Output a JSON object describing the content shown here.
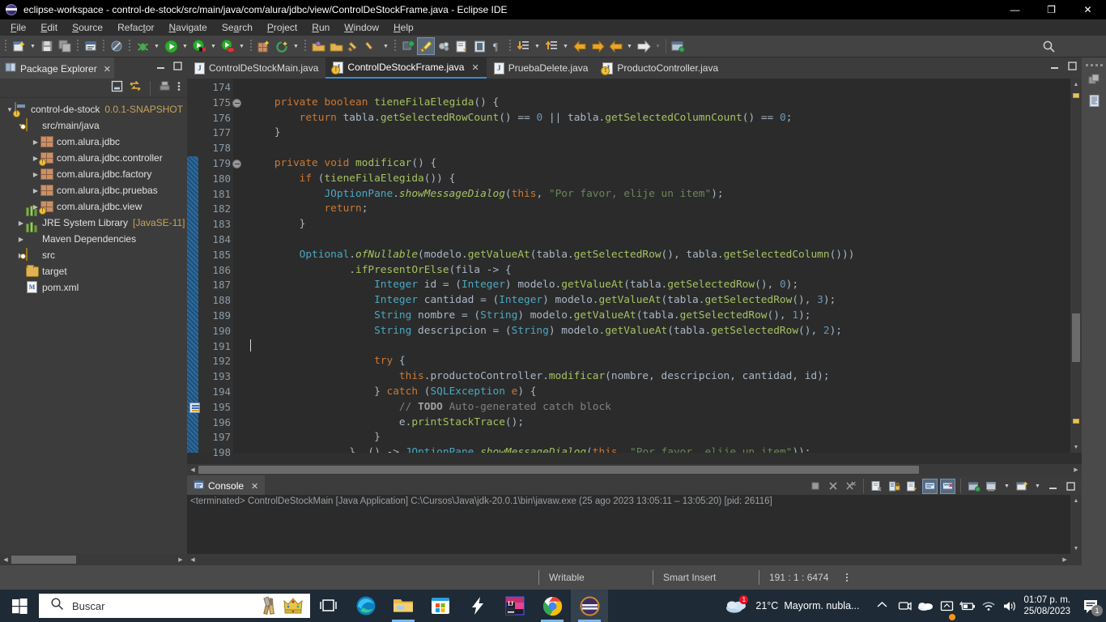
{
  "window": {
    "title": "eclipse-workspace - control-de-stock/src/main/java/com/alura/jdbc/view/ControlDeStockFrame.java - Eclipse IDE",
    "app_icon": "eclipse-icon",
    "restore_label": "❐",
    "close_label": "✕"
  },
  "menubar": [
    {
      "label": "File",
      "mnemonic": "F"
    },
    {
      "label": "Edit",
      "mnemonic": "E"
    },
    {
      "label": "Source",
      "mnemonic": "S"
    },
    {
      "label": "Refactor",
      "mnemonic": "t"
    },
    {
      "label": "Navigate",
      "mnemonic": "N"
    },
    {
      "label": "Search",
      "mnemonic": "a"
    },
    {
      "label": "Project",
      "mnemonic": "P"
    },
    {
      "label": "Run",
      "mnemonic": "R"
    },
    {
      "label": "Window",
      "mnemonic": "W"
    },
    {
      "label": "Help",
      "mnemonic": "H"
    }
  ],
  "package_explorer": {
    "tab_label": "Package Explorer",
    "close_label": "✕",
    "toolbar_icons": [
      "collapse-all-icon",
      "link-with-editor-icon",
      "view-menu-filter-icon",
      "view-menu-icon"
    ],
    "tree": [
      {
        "indent": 0,
        "twisty": "down",
        "icon": "java-project-icon",
        "label": "control-de-stock",
        "sub": "0.0.1-SNAPSHOT"
      },
      {
        "indent": 1,
        "twisty": "down",
        "icon": "source-folder-icon",
        "label": "src/main/java",
        "sub": ""
      },
      {
        "indent": 2,
        "twisty": "right",
        "icon": "package-icon",
        "label": "com.alura.jdbc",
        "sub": ""
      },
      {
        "indent": 2,
        "twisty": "right",
        "icon": "package-warning-icon",
        "label": "com.alura.jdbc.controller",
        "sub": ""
      },
      {
        "indent": 2,
        "twisty": "right",
        "icon": "package-icon",
        "label": "com.alura.jdbc.factory",
        "sub": ""
      },
      {
        "indent": 2,
        "twisty": "right",
        "icon": "package-icon",
        "label": "com.alura.jdbc.pruebas",
        "sub": ""
      },
      {
        "indent": 2,
        "twisty": "right",
        "icon": "package-warning-icon",
        "label": "com.alura.jdbc.view",
        "sub": ""
      },
      {
        "indent": 1,
        "twisty": "right",
        "icon": "library-icon",
        "label": "JRE System Library",
        "sub": "[JavaSE-11]"
      },
      {
        "indent": 1,
        "twisty": "right",
        "icon": "library-icon",
        "label": "Maven Dependencies",
        "sub": ""
      },
      {
        "indent": 1,
        "twisty": "right",
        "icon": "source-folder-icon",
        "label": "src",
        "sub": ""
      },
      {
        "indent": 1,
        "twisty": "none",
        "icon": "folder-icon",
        "label": "target",
        "sub": ""
      },
      {
        "indent": 1,
        "twisty": "none",
        "icon": "xml-file-icon",
        "label": "pom.xml",
        "sub": ""
      }
    ]
  },
  "editor": {
    "tabs": [
      {
        "label": "ControlDeStockMain.java",
        "icon": "java-file-icon",
        "active": false,
        "closable": false
      },
      {
        "label": "ControlDeStockFrame.java",
        "icon": "java-warning-file-icon",
        "active": true,
        "closable": true
      },
      {
        "label": "PruebaDelete.java",
        "icon": "java-file-icon",
        "active": false,
        "closable": false
      },
      {
        "label": "ProductoController.java",
        "icon": "java-warning-file-icon",
        "active": false,
        "closable": false
      }
    ],
    "close_label": "✕",
    "first_line": 174,
    "last_line": 198,
    "fold_lines": [
      175,
      179
    ],
    "todo_marker_line": 195,
    "caret_line": 191,
    "lines": [
      {
        "n": 174,
        "tokens": []
      },
      {
        "n": 175,
        "tokens": [
          {
            "t": "    ",
            "c": "t"
          },
          {
            "t": "private",
            "c": "k"
          },
          {
            "t": " ",
            "c": "t"
          },
          {
            "t": "boolean",
            "c": "k"
          },
          {
            "t": " ",
            "c": "t"
          },
          {
            "t": "tieneFilaElegida",
            "c": "m"
          },
          {
            "t": "() {",
            "c": "t"
          }
        ]
      },
      {
        "n": 176,
        "tokens": [
          {
            "t": "        ",
            "c": "t"
          },
          {
            "t": "return",
            "c": "k"
          },
          {
            "t": " tabla.",
            "c": "t"
          },
          {
            "t": "getSelectedRowCount",
            "c": "m"
          },
          {
            "t": "() ",
            "c": "t"
          },
          {
            "t": "==",
            "c": "t"
          },
          {
            "t": " ",
            "c": "t"
          },
          {
            "t": "0",
            "c": "n"
          },
          {
            "t": " || tabla.",
            "c": "t"
          },
          {
            "t": "getSelectedColumnCount",
            "c": "m"
          },
          {
            "t": "() == ",
            "c": "t"
          },
          {
            "t": "0",
            "c": "n"
          },
          {
            "t": ";",
            "c": "t"
          }
        ]
      },
      {
        "n": 177,
        "tokens": [
          {
            "t": "    }",
            "c": "t"
          }
        ]
      },
      {
        "n": 178,
        "tokens": []
      },
      {
        "n": 179,
        "tokens": [
          {
            "t": "    ",
            "c": "t"
          },
          {
            "t": "private",
            "c": "k"
          },
          {
            "t": " ",
            "c": "t"
          },
          {
            "t": "void",
            "c": "k"
          },
          {
            "t": " ",
            "c": "t"
          },
          {
            "t": "modificar",
            "c": "m"
          },
          {
            "t": "() {",
            "c": "t"
          }
        ]
      },
      {
        "n": 180,
        "tokens": [
          {
            "t": "        ",
            "c": "t"
          },
          {
            "t": "if",
            "c": "k"
          },
          {
            "t": " (",
            "c": "t"
          },
          {
            "t": "tieneFilaElegida",
            "c": "m"
          },
          {
            "t": "()) {",
            "c": "t"
          }
        ]
      },
      {
        "n": 181,
        "tokens": [
          {
            "t": "            ",
            "c": "t"
          },
          {
            "t": "JOptionPane",
            "c": "cyan"
          },
          {
            "t": ".",
            "c": "t"
          },
          {
            "t": "showMessageDialog",
            "c": "m it"
          },
          {
            "t": "(",
            "c": "t"
          },
          {
            "t": "this",
            "c": "k"
          },
          {
            "t": ", ",
            "c": "t"
          },
          {
            "t": "\"Por favor, elije un item\"",
            "c": "st"
          },
          {
            "t": ");",
            "c": "t"
          }
        ]
      },
      {
        "n": 182,
        "tokens": [
          {
            "t": "            ",
            "c": "t"
          },
          {
            "t": "return",
            "c": "k"
          },
          {
            "t": ";",
            "c": "t"
          }
        ]
      },
      {
        "n": 183,
        "tokens": [
          {
            "t": "        }",
            "c": "t"
          }
        ]
      },
      {
        "n": 184,
        "tokens": []
      },
      {
        "n": 185,
        "tokens": [
          {
            "t": "        ",
            "c": "t"
          },
          {
            "t": "Optional",
            "c": "cyan"
          },
          {
            "t": ".",
            "c": "t"
          },
          {
            "t": "ofNullable",
            "c": "m it"
          },
          {
            "t": "(modelo.",
            "c": "t"
          },
          {
            "t": "getValueAt",
            "c": "m"
          },
          {
            "t": "(tabla.",
            "c": "t"
          },
          {
            "t": "getSelectedRow",
            "c": "m"
          },
          {
            "t": "(), tabla.",
            "c": "t"
          },
          {
            "t": "getSelectedColumn",
            "c": "m"
          },
          {
            "t": "()))",
            "c": "t"
          }
        ]
      },
      {
        "n": 186,
        "tokens": [
          {
            "t": "                .",
            "c": "t"
          },
          {
            "t": "ifPresentOrElse",
            "c": "m"
          },
          {
            "t": "(fila -> {",
            "c": "t"
          }
        ]
      },
      {
        "n": 187,
        "tokens": [
          {
            "t": "                    ",
            "c": "t"
          },
          {
            "t": "Integer",
            "c": "cyan"
          },
          {
            "t": " id = (",
            "c": "t"
          },
          {
            "t": "Integer",
            "c": "cyan"
          },
          {
            "t": ") modelo.",
            "c": "t"
          },
          {
            "t": "getValueAt",
            "c": "m"
          },
          {
            "t": "(tabla.",
            "c": "t"
          },
          {
            "t": "getSelectedRow",
            "c": "m"
          },
          {
            "t": "(), ",
            "c": "t"
          },
          {
            "t": "0",
            "c": "n"
          },
          {
            "t": ");",
            "c": "t"
          }
        ]
      },
      {
        "n": 188,
        "tokens": [
          {
            "t": "                    ",
            "c": "t"
          },
          {
            "t": "Integer",
            "c": "cyan"
          },
          {
            "t": " cantidad = (",
            "c": "t"
          },
          {
            "t": "Integer",
            "c": "cyan"
          },
          {
            "t": ") modelo.",
            "c": "t"
          },
          {
            "t": "getValueAt",
            "c": "m"
          },
          {
            "t": "(tabla.",
            "c": "t"
          },
          {
            "t": "getSelectedRow",
            "c": "m"
          },
          {
            "t": "(), ",
            "c": "t"
          },
          {
            "t": "3",
            "c": "n"
          },
          {
            "t": ");",
            "c": "t"
          }
        ]
      },
      {
        "n": 189,
        "tokens": [
          {
            "t": "                    ",
            "c": "t"
          },
          {
            "t": "String",
            "c": "cyan"
          },
          {
            "t": " nombre = (",
            "c": "t"
          },
          {
            "t": "String",
            "c": "cyan"
          },
          {
            "t": ") modelo.",
            "c": "t"
          },
          {
            "t": "getValueAt",
            "c": "m"
          },
          {
            "t": "(tabla.",
            "c": "t"
          },
          {
            "t": "getSelectedRow",
            "c": "m"
          },
          {
            "t": "(), ",
            "c": "t"
          },
          {
            "t": "1",
            "c": "n"
          },
          {
            "t": ");",
            "c": "t"
          }
        ]
      },
      {
        "n": 190,
        "tokens": [
          {
            "t": "                    ",
            "c": "t"
          },
          {
            "t": "String",
            "c": "cyan"
          },
          {
            "t": " descripcion = (",
            "c": "t"
          },
          {
            "t": "String",
            "c": "cyan"
          },
          {
            "t": ") modelo.",
            "c": "t"
          },
          {
            "t": "getValueAt",
            "c": "m"
          },
          {
            "t": "(tabla.",
            "c": "t"
          },
          {
            "t": "getSelectedRow",
            "c": "m"
          },
          {
            "t": "(), ",
            "c": "t"
          },
          {
            "t": "2",
            "c": "n"
          },
          {
            "t": ");",
            "c": "t"
          }
        ]
      },
      {
        "n": 191,
        "tokens": []
      },
      {
        "n": 192,
        "tokens": [
          {
            "t": "                    ",
            "c": "t"
          },
          {
            "t": "try",
            "c": "k"
          },
          {
            "t": " {",
            "c": "t"
          }
        ]
      },
      {
        "n": 193,
        "tokens": [
          {
            "t": "                        ",
            "c": "t"
          },
          {
            "t": "this",
            "c": "k"
          },
          {
            "t": ".productoController.",
            "c": "t"
          },
          {
            "t": "modificar",
            "c": "m"
          },
          {
            "t": "(nombre, descripcion, cantidad, id);",
            "c": "t"
          }
        ]
      },
      {
        "n": 194,
        "tokens": [
          {
            "t": "                    } ",
            "c": "t"
          },
          {
            "t": "catch",
            "c": "k"
          },
          {
            "t": " (",
            "c": "t"
          },
          {
            "t": "SQLException",
            "c": "cyan"
          },
          {
            "t": " ",
            "c": "t"
          },
          {
            "t": "e",
            "c": "k"
          },
          {
            "t": ") {",
            "c": "t"
          }
        ]
      },
      {
        "n": 195,
        "tokens": [
          {
            "t": "                        ",
            "c": "t"
          },
          {
            "t": "// ",
            "c": "cm"
          },
          {
            "t": "TODO",
            "c": "cmb"
          },
          {
            "t": " Auto-generated catch block",
            "c": "cm"
          }
        ]
      },
      {
        "n": 196,
        "tokens": [
          {
            "t": "                        e.",
            "c": "t"
          },
          {
            "t": "printStackTrace",
            "c": "m"
          },
          {
            "t": "();",
            "c": "t"
          }
        ]
      },
      {
        "n": 197,
        "tokens": [
          {
            "t": "                    }",
            "c": "t"
          }
        ]
      },
      {
        "n": 198,
        "tokens": [
          {
            "t": "                }, () -> ",
            "c": "t"
          },
          {
            "t": "JOptionPane",
            "c": "cyan"
          },
          {
            "t": ".",
            "c": "t"
          },
          {
            "t": "showMessageDialog",
            "c": "m it"
          },
          {
            "t": "(",
            "c": "t"
          },
          {
            "t": "this",
            "c": "k"
          },
          {
            "t": ", ",
            "c": "t"
          },
          {
            "t": "\"Por favor, elije un item\"",
            "c": "st"
          },
          {
            "t": "));",
            "c": "t"
          }
        ]
      }
    ]
  },
  "console": {
    "tab_label": "Console",
    "close_label": "✕",
    "status_line": "<terminated> ControlDeStockMain [Java Application] C:\\Cursos\\Java\\jdk-20.0.1\\bin\\javaw.exe  (25 ago 2023 13:05:11 – 13:05:20) [pid: 26116]",
    "tools": [
      "terminate-icon",
      "remove-launch-icon",
      "remove-all-terminated-icon",
      "clear-console-icon",
      "scroll-lock-icon",
      "pin-console-icon",
      "display-selected-console-icon",
      "show-console-on-output-icon",
      "open-console-icon",
      "new-console-view-icon",
      "minimize-icon",
      "maximize-icon"
    ]
  },
  "right_bar": {
    "icons": [
      "restore-icon",
      "outline-view-icon"
    ]
  },
  "statusbar": {
    "writable": "Writable",
    "insert_mode": "Smart Insert",
    "position": "191 : 1 : 6474"
  },
  "taskbar": {
    "start_label": "start-icon",
    "search_placeholder": "Buscar",
    "search_icon": "search-icon",
    "search_deco": [
      "paintbrush-icon",
      "crown-icon"
    ],
    "apps": [
      {
        "name": "task-view-icon",
        "active": false,
        "running": false
      },
      {
        "name": "edge-icon",
        "active": false,
        "running": false
      },
      {
        "name": "file-explorer-icon",
        "active": false,
        "running": true
      },
      {
        "name": "microsoft-store-icon",
        "active": false,
        "running": false
      },
      {
        "name": "lightning-icon",
        "active": false,
        "running": false
      },
      {
        "name": "intellij-idea-icon",
        "active": false,
        "running": false
      },
      {
        "name": "chrome-icon",
        "active": false,
        "running": true
      },
      {
        "name": "eclipse-icon",
        "active": true,
        "running": true
      }
    ],
    "tray": {
      "weather_temp": "21°C",
      "weather_desc": "Mayorm. nubla...",
      "chevron": "⌃",
      "icons": [
        "webcam-icon",
        "onedrive-icon",
        "display-icon",
        "battery-icon",
        "wifi-icon",
        "volume-icon"
      ],
      "time": "01:07 p. m.",
      "date": "25/08/2023",
      "notification_count": "1"
    }
  },
  "colors": {
    "accent": "#3b8bd0",
    "titlebar_bg": "#000000",
    "toolbar_bg": "#434343",
    "panel_bg": "#3c3c3c",
    "editor_bg": "#2b2b2b",
    "taskbar_bg": "#1e2a35",
    "keyword": "#cc7832",
    "string": "#6a8759",
    "method": "#a5c261",
    "type": "#4aa8c0",
    "number": "#6897bb",
    "comment": "#808080"
  }
}
